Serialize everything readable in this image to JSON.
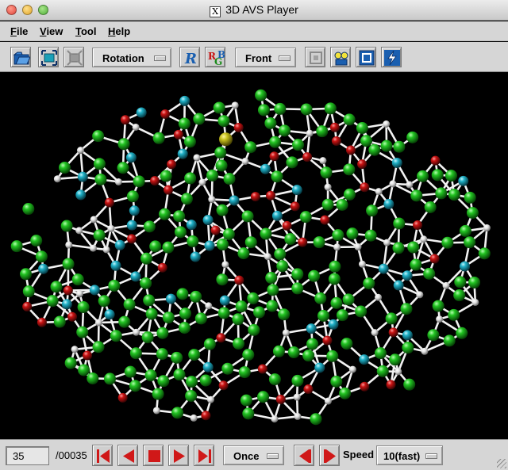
{
  "window": {
    "title": "3D AVS Player",
    "x11_glyph": "X"
  },
  "menu": {
    "items": [
      {
        "mnemonic": "F",
        "rest": "ile"
      },
      {
        "mnemonic": "V",
        "rest": "iew"
      },
      {
        "mnemonic": "T",
        "rest": "ool"
      },
      {
        "mnemonic": "H",
        "rest": "elp"
      }
    ]
  },
  "toolbar": {
    "open_icon": "folder-open-icon",
    "fit_icon": "fit-view-icon",
    "reset_icon": "reset-view-icon",
    "mode_combo": "Rotation",
    "r_icon": "R",
    "rgb_icon": [
      "R",
      "G",
      "B"
    ],
    "view_combo": "Front",
    "frame_icon": "frame-icon",
    "lights_icon": "lights-icon",
    "box_icon": "bounding-box-icon",
    "flash_icon": "lightning-icon"
  },
  "status": {
    "current_frame": "35",
    "total_frames": "/00035",
    "loop_mode": "Once",
    "speed_label": "Speed",
    "speed_value": "10(fast)"
  },
  "colors": {
    "carbon": "#1fbf1f",
    "nitrogen": "#1fb0c6",
    "oxygen": "#c81212",
    "hydrogen": "#e6e6e6",
    "sulfur": "#c9c21e",
    "bond": "#f2f2f2",
    "player_red": "#d01818"
  }
}
